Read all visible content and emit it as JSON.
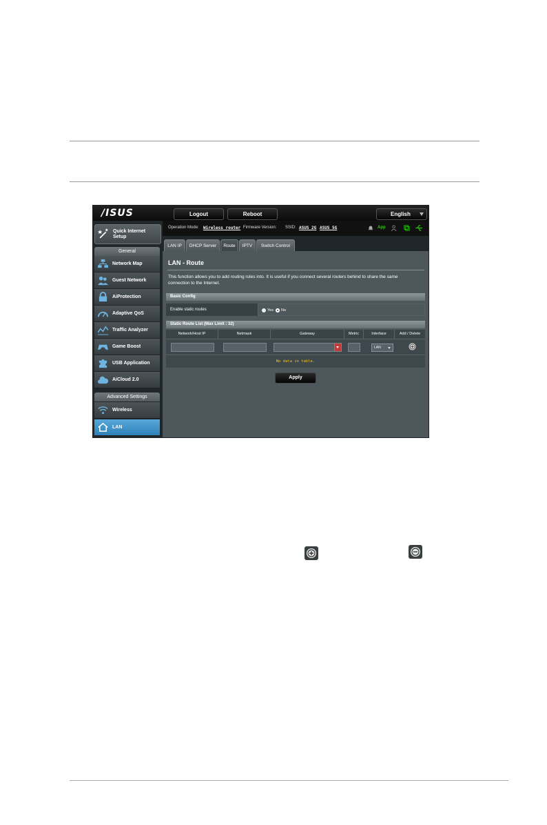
{
  "header": {
    "logo": "/ISUS",
    "logout_label": "Logout",
    "reboot_label": "Reboot",
    "language": "English"
  },
  "status": {
    "op_mode_label": "Operation Mode:",
    "op_mode_value": "Wireless router",
    "firmware_label": "Firmware Version:",
    "ssid_label": "SSID:",
    "ssid_2g": "ASUS_2G",
    "ssid_5g": "ASUS_5G",
    "app_label": "App"
  },
  "sidebar": {
    "quick_setup": "Quick Internet Setup",
    "general_label": "General",
    "items": [
      {
        "label": "Network Map",
        "icon": "network-map-icon"
      },
      {
        "label": "Guest Network",
        "icon": "guest-network-icon"
      },
      {
        "label": "AiProtection",
        "icon": "lock-icon"
      },
      {
        "label": "Adaptive QoS",
        "icon": "gauge-icon"
      },
      {
        "label": "Traffic Analyzer",
        "icon": "traffic-chart-icon"
      },
      {
        "label": "Game Boost",
        "icon": "gamepad-icon"
      },
      {
        "label": "USB Application",
        "icon": "puzzle-icon"
      },
      {
        "label": "AiCloud 2.0",
        "icon": "cloud-icon"
      }
    ],
    "advanced_label": "Advanced Settings",
    "adv_items": [
      {
        "label": "Wireless",
        "icon": "wifi-icon"
      },
      {
        "label": "LAN",
        "icon": "home-icon"
      }
    ]
  },
  "tabs": [
    "LAN IP",
    "DHCP Server",
    "Route",
    "IPTV",
    "Switch Control"
  ],
  "main": {
    "title": "LAN - Route",
    "description": "This function allows you to add routing rules into. It is useful if you connect several routers behind to share the same connection to the Internet.",
    "basic_config_title": "Basic Config",
    "enable_static_label": "Enable static routes",
    "yes_label": "Yes",
    "no_label": "No",
    "static_list_title": "Static Route List (Max Limit : 32)",
    "columns": [
      "Network/Host IP",
      "Netmask",
      "Gateway",
      "Metric",
      "Interface",
      "Add / Delete"
    ],
    "interface_value": "LAN",
    "no_data": "No data in table.",
    "apply_label": "Apply"
  },
  "colors": {
    "accent_green": "#22d400",
    "no_data_yellow": "#f5c518",
    "gateway_arrow": "#c13a3a"
  }
}
